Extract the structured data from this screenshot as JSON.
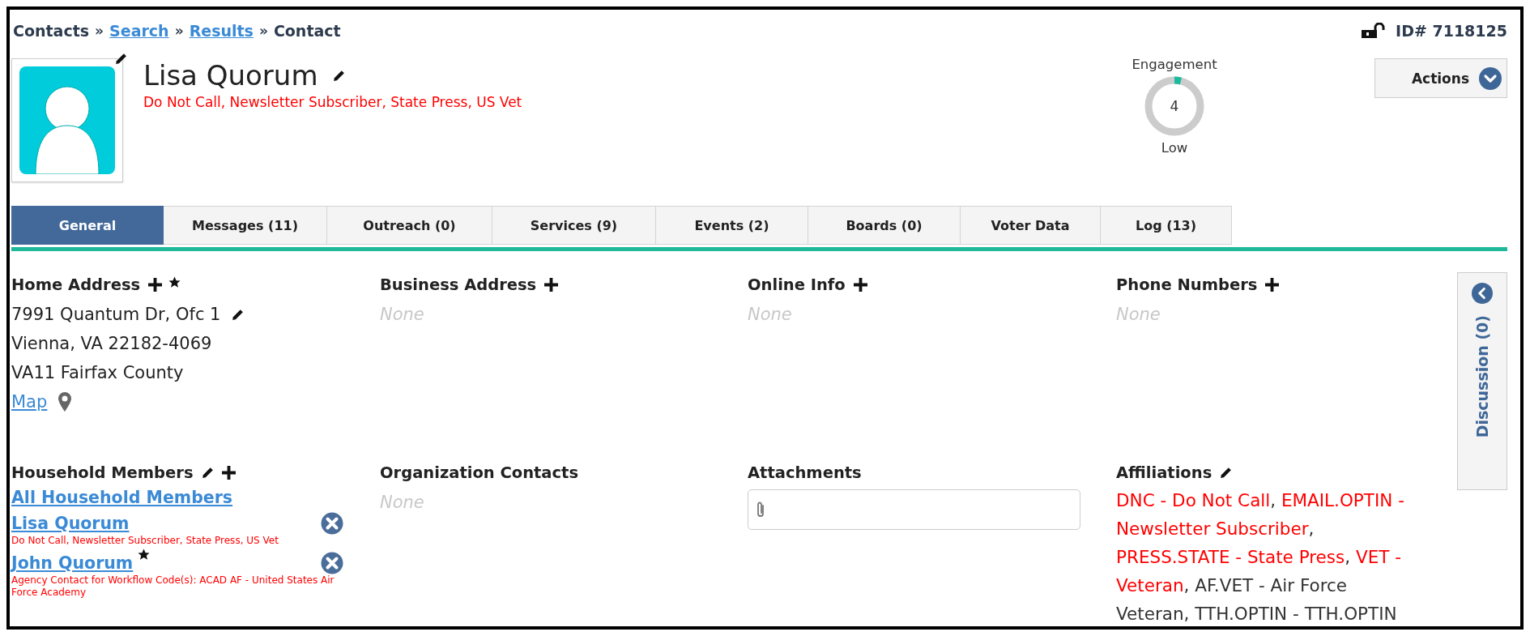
{
  "breadcrumb": [
    {
      "kind": "text",
      "text": "Contacts"
    },
    {
      "kind": "separator",
      "text": "»"
    },
    {
      "kind": "link",
      "text": "Search"
    },
    {
      "kind": "separator",
      "text": "»"
    },
    {
      "kind": "link",
      "text": "Results"
    },
    {
      "kind": "separator",
      "text": "»"
    },
    {
      "kind": "text",
      "text": "Contact"
    }
  ],
  "locked": false,
  "record_id": "ID# 7118125",
  "contact": {
    "name": "Lisa Quorum",
    "tags": "Do Not Call, Newsletter Subscriber, State Press, US Vet"
  },
  "engagement": {
    "label": "Engagement",
    "score": "4",
    "rating": "Low",
    "level": 0.04
  },
  "actions_button": "Actions",
  "tabs": [
    {
      "label": "General",
      "selected": true
    },
    {
      "label": "Messages (11)",
      "selected": false
    },
    {
      "label": "Outreach (0)",
      "selected": false
    },
    {
      "label": "Services (9)",
      "selected": false
    },
    {
      "label": "Events (2)",
      "selected": false
    },
    {
      "label": "Boards (0)",
      "selected": false
    },
    {
      "label": "Voter Data",
      "selected": false
    },
    {
      "label": "Log (13)",
      "selected": false
    }
  ],
  "sections": [
    {
      "kind": "address",
      "title": "Home Address",
      "can_add": true,
      "starred": true,
      "editable": true,
      "lines": [
        "7991 Quantum Dr, Ofc 1",
        "Vienna, VA 22182-4069",
        "VA11 Fairfax County"
      ],
      "map_link": "Map"
    },
    {
      "kind": "empty",
      "title": "Business Address",
      "can_add": true,
      "empty_text": "None"
    },
    {
      "kind": "empty",
      "title": "Online Info",
      "can_add": true,
      "empty_text": "None"
    },
    {
      "kind": "empty",
      "title": "Phone Numbers",
      "can_add": true,
      "empty_text": "None"
    },
    {
      "kind": "household",
      "title": "Household Members",
      "editable": true,
      "can_add": true,
      "all_link": "All Household Members",
      "members": [
        {
          "name": "Lisa Quorum",
          "starred": false,
          "note": "Do Not Call, Newsletter Subscriber, State Press, US Vet"
        },
        {
          "name": "John Quorum",
          "starred": true,
          "note": "Agency Contact for Workflow Code(s): ACAD AF - United States Air Force Academy"
        }
      ]
    },
    {
      "kind": "empty",
      "title": "Organization Contacts",
      "can_add": false,
      "empty_text": "None"
    },
    {
      "kind": "attachments",
      "title": "Attachments"
    },
    {
      "kind": "affiliations",
      "title": "Affiliations",
      "editable": true,
      "separator": ", ",
      "items": [
        {
          "text": "DNC - Do Not Call",
          "color": "#ff0000"
        },
        {
          "text": "EMAIL.OPTIN - Newsletter Subscriber",
          "color": "#ff0000"
        },
        {
          "text": "PRESS.STATE - State Press",
          "color": "#ff0000"
        },
        {
          "text": "VET - Veteran",
          "color": "#ff0000"
        },
        {
          "text": "AF.VET - Air Force Veteran",
          "color": "#333333"
        },
        {
          "text": "TTH.OPTIN - TTH.OPTIN",
          "color": "#333333"
        }
      ]
    }
  ],
  "discussion": {
    "label": "Discussion (0)"
  }
}
